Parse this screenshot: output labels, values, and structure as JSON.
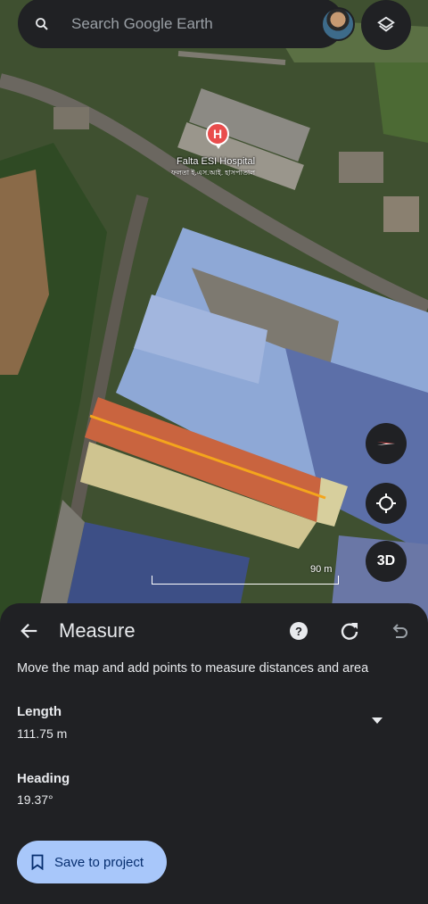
{
  "search": {
    "placeholder": "Search Google Earth"
  },
  "map": {
    "poi_name": "Falta ESI Hospital",
    "poi_subtitle": "ফলতা ই.এস.আই. হাসপাতাল",
    "poi_badge": "H",
    "scale_label": "90 m",
    "measure_line_color": "#f4a51c"
  },
  "controls": {
    "three_d_label": "3D"
  },
  "measure": {
    "title": "Measure",
    "help_label": "?",
    "hint": "Move the map and add points to measure distances and area",
    "length_label": "Length",
    "length_value": "111.75 m",
    "heading_label": "Heading",
    "heading_value": "19.37°",
    "save_label": "Save to project"
  },
  "colors": {
    "sheet_bg": "#202124",
    "button_bg": "#a8c7fa",
    "pin_red": "#e94d4d"
  },
  "icons": [
    "search-icon",
    "avatar",
    "layers-icon",
    "compass-icon",
    "locate-icon",
    "back-arrow-icon",
    "help-icon",
    "redo-icon",
    "undo-icon",
    "dropdown-icon",
    "bookmark-icon"
  ]
}
